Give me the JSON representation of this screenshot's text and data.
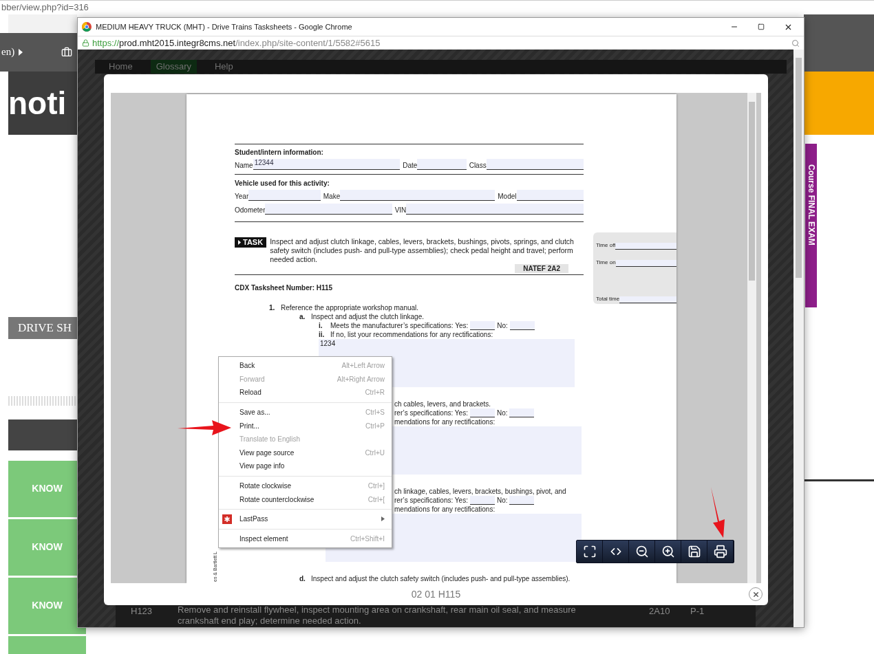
{
  "background_page": {
    "address_fragment": "bber/view.php?id=316",
    "nav_fragment": "en)",
    "logo_fragment": "noti",
    "side_banner": "Course FINAL EXAM",
    "section_tab": "DRIVE SH",
    "know_buttons": [
      "KNOW",
      "KNOW",
      "KNOW"
    ]
  },
  "popup": {
    "title": "MEDIUM HEAVY TRUCK (MHT) - Drive Trains Tasksheets - Google Chrome",
    "url": {
      "scheme": "https://",
      "host": "prod.mht2015.integr8cms.net",
      "path": "/index.php/site-content/1/5582#5615"
    },
    "nav": [
      {
        "label": "Home",
        "selected": false
      },
      {
        "label": "Glossary",
        "selected": true
      },
      {
        "label": "Help",
        "selected": false
      }
    ],
    "behind_row": {
      "code": "H123",
      "task": "Remove and reinstall flywheel, inspect mounting area on crankshaft, rear main oil seal, and measure crankshaft end play; determine needed action.",
      "natef": "2A10",
      "priority": "P-1"
    },
    "document": {
      "student_heading": "Student/intern information:",
      "student_fields": [
        {
          "label": "Name",
          "value": "12344"
        },
        {
          "label": "Date"
        },
        {
          "label": "Class"
        }
      ],
      "vehicle_heading": "Vehicle used for this activity:",
      "vehicle_rows": [
        [
          {
            "label": "Year"
          },
          {
            "label": "Make"
          },
          {
            "label": "Model"
          }
        ],
        [
          {
            "label": "Odometer"
          },
          {
            "label": "VIN"
          }
        ]
      ],
      "task_tag": "TASK",
      "task_text": "Inspect and adjust clutch linkage, cables, levers, brackets, bushings, pivots, springs, and clutch safety switch (includes push- and pull-type assemblies); check pedal height and travel; perform needed action.",
      "natef": "NATEF 2A2",
      "time_fields": [
        "Time off",
        "Time on",
        "Total time"
      ],
      "tasksheet_number": "CDX Tasksheet Number: H115",
      "steps": [
        {
          "marker": "1.",
          "kind": "text",
          "text": "Reference the appropriate workshop manual.",
          "children": [
            {
              "marker": "a.",
              "kind": "text",
              "text": "Inspect and adjust the clutch linkage.",
              "children": [
                {
                  "marker": "i.",
                  "kind": "yes_no",
                  "text": "Meets the manufacturer’s specifications: Yes:",
                  "no_label": "No:"
                },
                {
                  "marker": "ii.",
                  "kind": "answer",
                  "text": "If no, list your recommendations for any rectifications:",
                  "answer": "1234"
                }
              ]
            },
            {
              "kind": "text",
              "text": "ch cables, levers, and brackets.",
              "children": [
                {
                  "kind": "yes_no",
                  "text": "rer’s specifications: Yes:",
                  "no_label": "No:"
                },
                {
                  "kind": "answer",
                  "text": "mendations for any rectifications:"
                }
              ]
            },
            {
              "kind": "text",
              "text": "ch linkage, cables, levers, brackets, bushings, pivot, and",
              "children": [
                {
                  "kind": "yes_no",
                  "text": "rer’s specifications: Yes:",
                  "no_label": "No:"
                },
                {
                  "kind": "answer",
                  "text": "mendations for any rectifications:"
                }
              ]
            },
            {
              "marker": "d.",
              "kind": "text",
              "text": "Inspect and adjust the clutch safety switch (includes push- and pull-type assemblies)."
            }
          ]
        }
      ],
      "side_note": "es & Bartlett L"
    },
    "viewer_toolbar": [
      {
        "kind": "fit_page"
      },
      {
        "kind": "fit_width"
      },
      {
        "kind": "zoom_out"
      },
      {
        "kind": "zoom_in"
      },
      {
        "kind": "save"
      },
      {
        "kind": "print"
      }
    ],
    "footer": "02 01 H115"
  },
  "context_menu": {
    "groups": [
      [
        {
          "kind": "command",
          "label": "Back",
          "shortcut": "Alt+Left Arrow",
          "disabled": false
        },
        {
          "kind": "command",
          "label": "Forward",
          "shortcut": "Alt+Right Arrow",
          "disabled": true
        },
        {
          "kind": "command",
          "label": "Reload",
          "shortcut": "Ctrl+R",
          "disabled": false
        }
      ],
      [
        {
          "kind": "command",
          "label": "Save as...",
          "shortcut": "Ctrl+S",
          "disabled": false
        },
        {
          "kind": "command",
          "label": "Print...",
          "shortcut": "Ctrl+P",
          "disabled": false
        },
        {
          "kind": "command",
          "label": "Translate to English",
          "disabled": true
        },
        {
          "kind": "command",
          "label": "View page source",
          "shortcut": "Ctrl+U",
          "disabled": false
        },
        {
          "kind": "command",
          "label": "View page info",
          "disabled": false
        }
      ],
      [
        {
          "kind": "command",
          "label": "Rotate clockwise",
          "shortcut": "Ctrl+]",
          "disabled": false
        },
        {
          "kind": "command",
          "label": "Rotate counterclockwise",
          "shortcut": "Ctrl+[",
          "disabled": false
        }
      ],
      [
        {
          "kind": "submenu",
          "label": "LastPass",
          "disabled": false
        }
      ],
      [
        {
          "kind": "command",
          "label": "Inspect element",
          "shortcut": "Ctrl+Shift+I",
          "disabled": false
        }
      ]
    ]
  }
}
